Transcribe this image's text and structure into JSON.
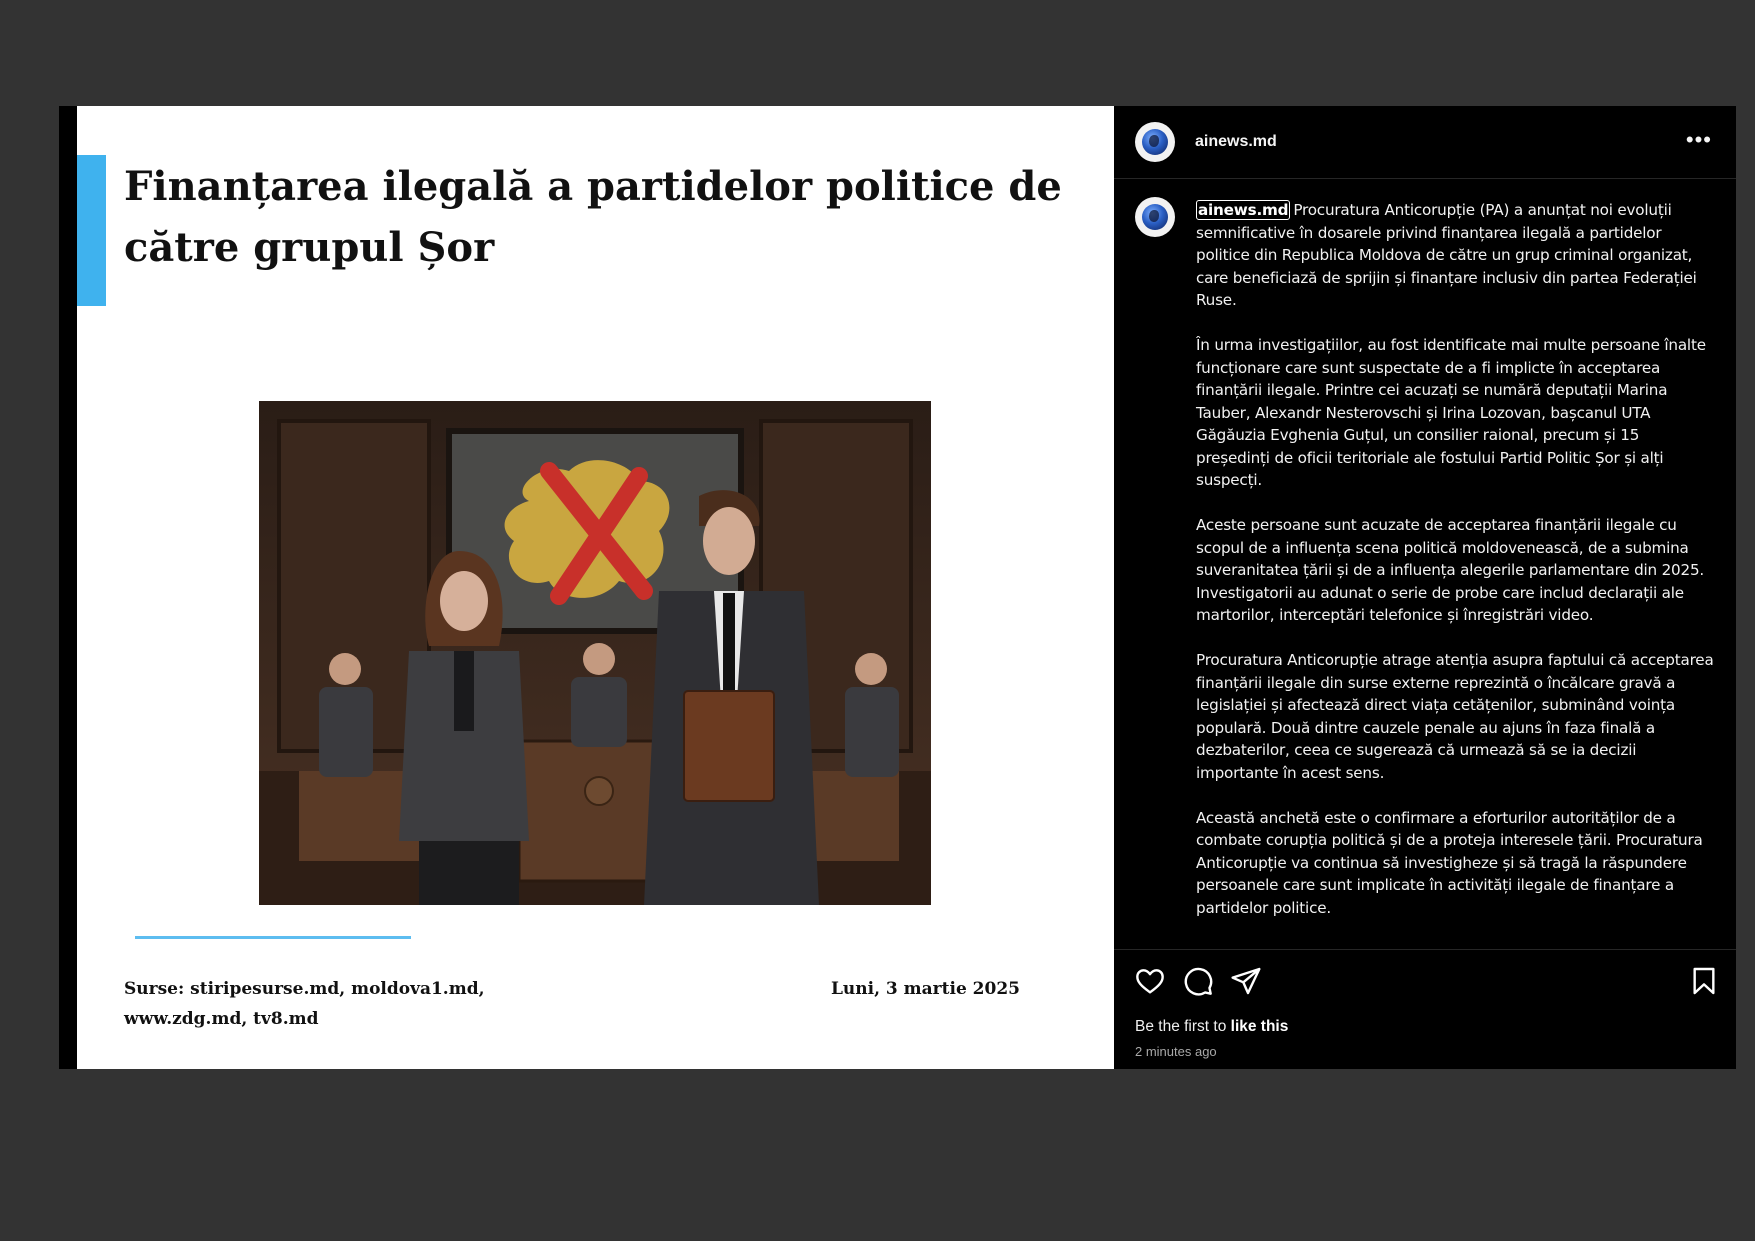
{
  "slide": {
    "headline": "Finanțarea ilegală a partidelor politice de către grupul Șor",
    "sources": "Surse: stiripesurse.md, moldova1.md, www.zdg.md, tv8.md",
    "date": "Luni, 3 martie 2025"
  },
  "post": {
    "username": "ainews.md",
    "caption_username": "ainews.md",
    "caption_paragraphs": [
      "Procuratura Anticorupție (PA) a anunțat noi evoluții semnificative în dosarele privind finanțarea ilegală a partidelor politice din Republica Moldova de către un grup criminal organizat, care beneficiază de sprijin și finanțare inclusiv din partea Federației Ruse.",
      "În urma investigațiilor, au fost identificate mai multe persoane înalte funcționare care sunt suspectate de a fi implicte în acceptarea finanțării ilegale. Printre cei acuzați se numără deputații Marina Tauber, Alexandr Nesterovschi și Irina Lozovan, bașcanul UTA Găgăuzia Evghenia Guțul, un consilier raional, precum și 15 președinți de oficii teritoriale ale fostului Partid Politic Șor și alți suspecți.",
      "Aceste persoane sunt acuzate de acceptarea finanțării ilegale cu scopul de a influența scena politică moldovenească, de a submina suveranitatea țării și de a influența alegerile parlamentare din 2025. Investigatorii au adunat o serie de probe care includ declarații ale martorilor, interceptări telefonice și înregistrări video.",
      "Procuratura Anticorupție atrage atenția asupra faptului că acceptarea finanțării ilegale din surse externe reprezintă o încălcare gravă a legislației și afectează direct viața cetățenilor, subminând voința populară. Două dintre cauzele penale au ajuns în faza finală a dezbaterilor, ceea ce sugerează că urmează să se ia decizii importante în acest sens.",
      "Această anchetă este o confirmare a eforturilor autorităților de a combate corupția politică și de a proteja interesele țării. Procuratura Anticorupție va continua să investigheze și să tragă la răspundere persoanele care sunt implicate în activități ilegale de finanțare a partidelor politice."
    ],
    "likes_prefix": "Be the first to ",
    "likes_action": "like this",
    "timestamp": "2 minutes ago",
    "icons": [
      "more-icon",
      "heart-icon",
      "comment-icon",
      "share-icon",
      "bookmark-icon"
    ]
  },
  "colors": {
    "page_background": "#333333",
    "accent": "#3fb2ee",
    "sidebar_background": "#000000"
  }
}
